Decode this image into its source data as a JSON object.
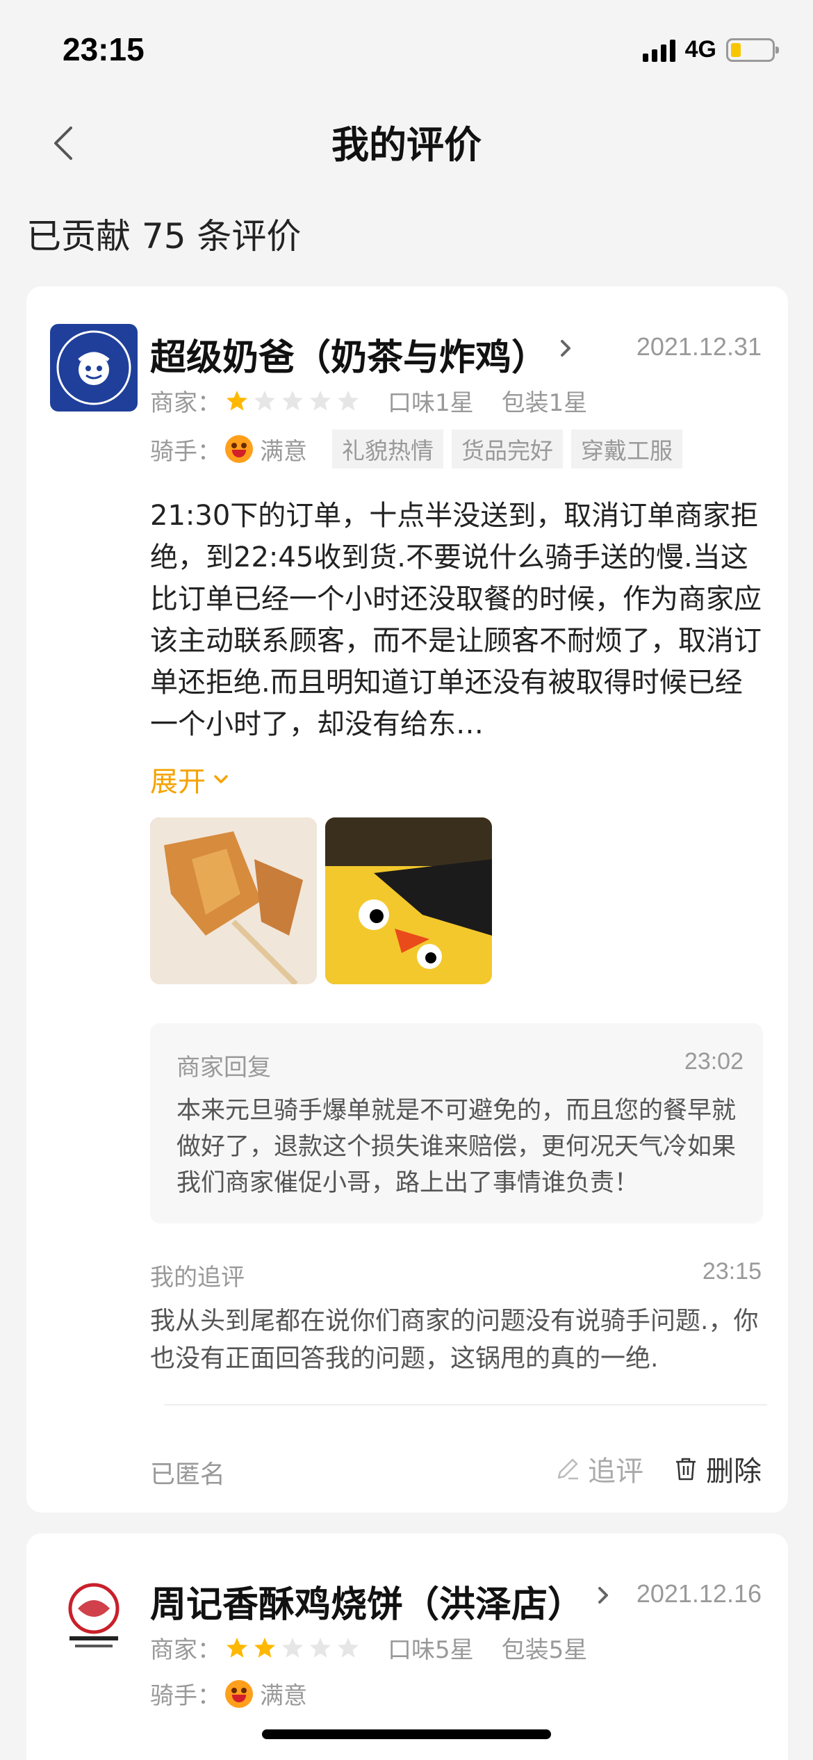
{
  "status": {
    "time": "23:15",
    "network": "4G"
  },
  "nav": {
    "title": "我的评价"
  },
  "summary": {
    "count_text": "已贡献 75 条评价"
  },
  "reviews": [
    {
      "shop": "超级奶爸（奶茶与炸鸡）",
      "date": "2021.12.31",
      "merchant_label": "商家：",
      "merchant_stars": 1,
      "taste": "口味1星",
      "package": "包装1星",
      "rider_label": "骑手：",
      "rider_rating": "满意",
      "tags": [
        "礼貌热情",
        "货品完好",
        "穿戴工服"
      ],
      "text": "21:30下的订单，十点半没送到，取消订单商家拒绝，到22:45收到货.不要说什么骑手送的慢.当这比订单已经一个小时还没取餐的时候，作为商家应该主动联系顾客，而不是让顾客不耐烦了，取消订单还拒绝.而且明知道订单还没有被取得时候已经一个小时了，却没有给东…",
      "expand": "展开",
      "reply_title": "商家回复",
      "reply_time": "23:02",
      "reply_text": "本来元旦骑手爆单就是不可避免的，而且您的餐早就做好了，退款这个损失谁来赔偿，更何况天气冷如果我们商家催促小哥，路上出了事情谁负责！",
      "follow_title": "我的追评",
      "follow_time": "23:15",
      "follow_text": "我从头到尾都在说你们商家的问题没有说骑手问题.，你也没有正面回答我的问题，这锅甩的真的一绝.",
      "anon": "已匿名",
      "action_follow": "追评",
      "action_delete": "删除"
    },
    {
      "shop": "周记香酥鸡烧饼（洪泽店）",
      "date": "2021.12.16",
      "merchant_label": "商家：",
      "merchant_stars": 2,
      "taste": "口味5星",
      "package": "包装5星",
      "rider_label": "骑手：",
      "rider_rating": "满意"
    }
  ],
  "colors": {
    "accent": "#f5a300",
    "star_on": "#ffb800",
    "star_off": "#e6e6e6"
  }
}
